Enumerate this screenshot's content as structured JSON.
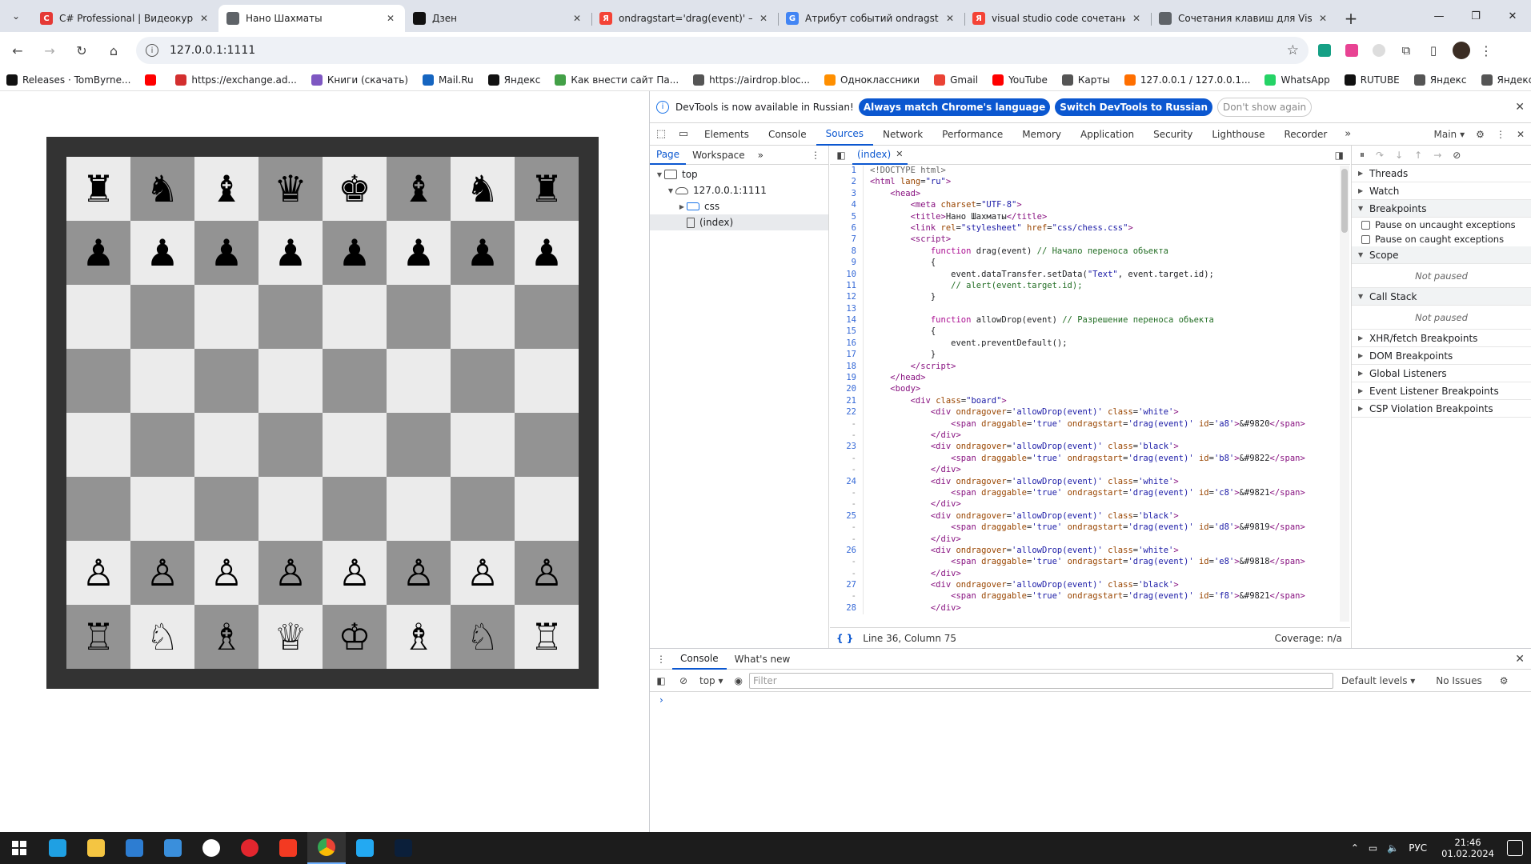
{
  "browser": {
    "tabs": [
      {
        "title": "C# Professional | Видеокурсы |",
        "fav_color": "#e53935",
        "fav_text": "C",
        "active": false
      },
      {
        "title": "Нано Шахматы",
        "fav_color": "#5f6368",
        "fav_text": "",
        "active": true
      },
      {
        "title": "Дзен",
        "fav_color": "#111111",
        "fav_text": "",
        "active": false
      },
      {
        "title": "ondragstart='drag(event)' — Ян",
        "fav_color": "#f44336",
        "fav_text": "Я",
        "active": false
      },
      {
        "title": "Атрибут событий ondragstart",
        "fav_color": "#4285f4",
        "fav_text": "G",
        "active": false
      },
      {
        "title": "visual studio code сочетания к",
        "fav_color": "#f44336",
        "fav_text": "Я",
        "active": false
      },
      {
        "title": "Сочетания клавиш для Visual",
        "fav_color": "#5f6368",
        "fav_text": "",
        "active": false
      }
    ],
    "url": "127.0.0.1:1111",
    "bookmarks": [
      {
        "label": "Releases · TomByrne...",
        "color": "#111111"
      },
      {
        "label": "",
        "color": "#ff0000"
      },
      {
        "label": "https://exchange.ad...",
        "color": "#d32f2f"
      },
      {
        "label": "Книги (скачать)",
        "color": "#7e57c2"
      },
      {
        "label": "Mail.Ru",
        "color": "#1565c0"
      },
      {
        "label": "Яндекс",
        "color": "#111111"
      },
      {
        "label": "Как внести сайт Па...",
        "color": "#43a047"
      },
      {
        "label": "https://airdrop.bloc...",
        "color": "#555555"
      },
      {
        "label": "Одноклассники",
        "color": "#ff8f00"
      },
      {
        "label": "Gmail",
        "color": "#ea4335"
      },
      {
        "label": "YouTube",
        "color": "#ff0000"
      },
      {
        "label": "Карты",
        "color": "#555555"
      },
      {
        "label": "127.0.0.1 / 127.0.0.1...",
        "color": "#ff6f00"
      },
      {
        "label": "WhatsApp",
        "color": "#25d366"
      },
      {
        "label": "RUTUBE",
        "color": "#111111"
      },
      {
        "label": "Яндекс",
        "color": "#555555"
      },
      {
        "label": "Яндекс Маркет",
        "color": "#555555"
      }
    ]
  },
  "board": {
    "rows": [
      [
        "♜",
        "♞",
        "♝",
        "♛",
        "♚",
        "♝",
        "♞",
        "♜"
      ],
      [
        "♟",
        "♟",
        "♟",
        "♟",
        "♟",
        "♟",
        "♟",
        "♟"
      ],
      [
        "",
        "",
        "",
        "",
        "",
        "",
        "",
        ""
      ],
      [
        "",
        "",
        "",
        "",
        "",
        "",
        "",
        ""
      ],
      [
        "",
        "",
        "",
        "",
        "",
        "",
        "",
        ""
      ],
      [
        "",
        "",
        "",
        "",
        "",
        "",
        "",
        ""
      ],
      [
        "♙",
        "♙",
        "♙",
        "♙",
        "♙",
        "♙",
        "♙",
        "♙"
      ],
      [
        "♖",
        "♘",
        "♗",
        "♕",
        "♔",
        "♗",
        "♘",
        "♖"
      ]
    ]
  },
  "devtools": {
    "infobar": {
      "message": "DevTools is now available in Russian!",
      "btn_match": "Always match Chrome's language",
      "btn_switch": "Switch DevTools to Russian",
      "btn_dismiss": "Don't show again"
    },
    "main_tabs": [
      "Elements",
      "Console",
      "Sources",
      "Network",
      "Performance",
      "Memory",
      "Application",
      "Security",
      "Lighthouse",
      "Recorder"
    ],
    "active_tab": "Sources",
    "target": "Main",
    "nav_tabs": [
      "Page",
      "Workspace"
    ],
    "tree": [
      {
        "label": "top",
        "depth": 0,
        "icon": "frame",
        "arrow": "▼"
      },
      {
        "label": "127.0.0.1:1111",
        "depth": 1,
        "icon": "cloud",
        "arrow": "▼"
      },
      {
        "label": "css",
        "depth": 2,
        "icon": "folder",
        "arrow": "▶"
      },
      {
        "label": "(index)",
        "depth": 2,
        "icon": "file",
        "arrow": ""
      }
    ],
    "open_file": "(index)",
    "code": [
      {
        "n": "1",
        "html": "<span class=\"c-doc\">&lt;!DOCTYPE html&gt;</span>"
      },
      {
        "n": "2",
        "html": "<span class=\"c-tag\">&lt;html</span> <span class=\"c-attr\">lang</span>=<span class=\"c-val\">\"ru\"</span><span class=\"c-tag\">&gt;</span>"
      },
      {
        "n": "3",
        "html": "    <span class=\"c-tag\">&lt;head&gt;</span>"
      },
      {
        "n": "4",
        "html": "        <span class=\"c-tag\">&lt;meta</span> <span class=\"c-attr\">charset</span>=<span class=\"c-val\">\"UTF-8\"</span><span class=\"c-tag\">&gt;</span>"
      },
      {
        "n": "5",
        "html": "        <span class=\"c-tag\">&lt;title&gt;</span>Нано Шахматы<span class=\"c-tag\">&lt;/title&gt;</span>"
      },
      {
        "n": "6",
        "html": "        <span class=\"c-tag\">&lt;link</span> <span class=\"c-attr\">rel</span>=<span class=\"c-val\">\"stylesheet\"</span> <span class=\"c-attr\">href</span>=<span class=\"c-val\">\"css/chess.css\"</span><span class=\"c-tag\">&gt;</span>"
      },
      {
        "n": "7",
        "html": "        <span class=\"c-tag\">&lt;script&gt;</span>"
      },
      {
        "n": "8",
        "html": "            <span class=\"c-kw\">function</span> drag(event) <span class=\"c-cm\">// Начало переноса объекта</span>"
      },
      {
        "n": "9",
        "html": "            {"
      },
      {
        "n": "10",
        "html": "                event.dataTransfer.setData(<span class=\"c-val\">\"Text\"</span>, event.target.id);"
      },
      {
        "n": "11",
        "html": "                <span class=\"c-cm\">// alert(event.target.id);</span>"
      },
      {
        "n": "12",
        "html": "            }"
      },
      {
        "n": "13",
        "html": ""
      },
      {
        "n": "14",
        "html": "            <span class=\"c-kw\">function</span> allowDrop(event) <span class=\"c-cm\">// Разрешение переноса объекта</span>"
      },
      {
        "n": "15",
        "html": "            {"
      },
      {
        "n": "16",
        "html": "                event.preventDefault();"
      },
      {
        "n": "17",
        "html": "            }"
      },
      {
        "n": "18",
        "html": "        <span class=\"c-tag\">&lt;/script&gt;</span>"
      },
      {
        "n": "19",
        "html": "    <span class=\"c-tag\">&lt;/head&gt;</span>"
      },
      {
        "n": "20",
        "html": "    <span class=\"c-tag\">&lt;body&gt;</span>"
      },
      {
        "n": "21",
        "html": "        <span class=\"c-tag\">&lt;div</span> <span class=\"c-attr\">class</span>=<span class=\"c-val\">\"board\"</span><span class=\"c-tag\">&gt;</span>"
      },
      {
        "n": "22",
        "html": "            <span class=\"c-tag\">&lt;div</span> <span class=\"c-attr\">ondragover</span>=<span class=\"c-val\">'allowDrop(event)'</span> <span class=\"c-attr\">class</span>=<span class=\"c-val\">'white'</span><span class=\"c-tag\">&gt;</span>"
      },
      {
        "n": "-",
        "html": "                <span class=\"c-tag\">&lt;span</span> <span class=\"c-attr\">draggable</span>=<span class=\"c-val\">'true'</span> <span class=\"c-attr\">ondragstart</span>=<span class=\"c-val\">'drag(event)'</span> <span class=\"c-attr\">id</span>=<span class=\"c-val\">'a8'</span><span class=\"c-tag\">&gt;</span>&amp;#9820<span class=\"c-tag\">&lt;/span&gt;</span>"
      },
      {
        "n": "-",
        "html": "            <span class=\"c-tag\">&lt;/div&gt;</span>"
      },
      {
        "n": "23",
        "html": "            <span class=\"c-tag\">&lt;div</span> <span class=\"c-attr\">ondragover</span>=<span class=\"c-val\">'allowDrop(event)'</span> <span class=\"c-attr\">class</span>=<span class=\"c-val\">'black'</span><span class=\"c-tag\">&gt;</span>"
      },
      {
        "n": "-",
        "html": "                <span class=\"c-tag\">&lt;span</span> <span class=\"c-attr\">draggable</span>=<span class=\"c-val\">'true'</span> <span class=\"c-attr\">ondragstart</span>=<span class=\"c-val\">'drag(event)'</span> <span class=\"c-attr\">id</span>=<span class=\"c-val\">'b8'</span><span class=\"c-tag\">&gt;</span>&amp;#9822<span class=\"c-tag\">&lt;/span&gt;</span>"
      },
      {
        "n": "-",
        "html": "            <span class=\"c-tag\">&lt;/div&gt;</span>"
      },
      {
        "n": "24",
        "html": "            <span class=\"c-tag\">&lt;div</span> <span class=\"c-attr\">ondragover</span>=<span class=\"c-val\">'allowDrop(event)'</span> <span class=\"c-attr\">class</span>=<span class=\"c-val\">'white'</span><span class=\"c-tag\">&gt;</span>"
      },
      {
        "n": "-",
        "html": "                <span class=\"c-tag\">&lt;span</span> <span class=\"c-attr\">draggable</span>=<span class=\"c-val\">'true'</span> <span class=\"c-attr\">ondragstart</span>=<span class=\"c-val\">'drag(event)'</span> <span class=\"c-attr\">id</span>=<span class=\"c-val\">'c8'</span><span class=\"c-tag\">&gt;</span>&amp;#9821<span class=\"c-tag\">&lt;/span&gt;</span>"
      },
      {
        "n": "-",
        "html": "            <span class=\"c-tag\">&lt;/div&gt;</span>"
      },
      {
        "n": "25",
        "html": "            <span class=\"c-tag\">&lt;div</span> <span class=\"c-attr\">ondragover</span>=<span class=\"c-val\">'allowDrop(event)'</span> <span class=\"c-attr\">class</span>=<span class=\"c-val\">'black'</span><span class=\"c-tag\">&gt;</span>"
      },
      {
        "n": "-",
        "html": "                <span class=\"c-tag\">&lt;span</span> <span class=\"c-attr\">draggable</span>=<span class=\"c-val\">'true'</span> <span class=\"c-attr\">ondragstart</span>=<span class=\"c-val\">'drag(event)'</span> <span class=\"c-attr\">id</span>=<span class=\"c-val\">'d8'</span><span class=\"c-tag\">&gt;</span>&amp;#9819<span class=\"c-tag\">&lt;/span&gt;</span>"
      },
      {
        "n": "-",
        "html": "            <span class=\"c-tag\">&lt;/div&gt;</span>"
      },
      {
        "n": "26",
        "html": "            <span class=\"c-tag\">&lt;div</span> <span class=\"c-attr\">ondragover</span>=<span class=\"c-val\">'allowDrop(event)'</span> <span class=\"c-attr\">class</span>=<span class=\"c-val\">'white'</span><span class=\"c-tag\">&gt;</span>"
      },
      {
        "n": "-",
        "html": "                <span class=\"c-tag\">&lt;span</span> <span class=\"c-attr\">draggable</span>=<span class=\"c-val\">'true'</span> <span class=\"c-attr\">ondragstart</span>=<span class=\"c-val\">'drag(event)'</span> <span class=\"c-attr\">id</span>=<span class=\"c-val\">'e8'</span><span class=\"c-tag\">&gt;</span>&amp;#9818<span class=\"c-tag\">&lt;/span&gt;</span>"
      },
      {
        "n": "-",
        "html": "            <span class=\"c-tag\">&lt;/div&gt;</span>"
      },
      {
        "n": "27",
        "html": "            <span class=\"c-tag\">&lt;div</span> <span class=\"c-attr\">ondragover</span>=<span class=\"c-val\">'allowDrop(event)'</span> <span class=\"c-attr\">class</span>=<span class=\"c-val\">'black'</span><span class=\"c-tag\">&gt;</span>"
      },
      {
        "n": "-",
        "html": "                <span class=\"c-tag\">&lt;span</span> <span class=\"c-attr\">draggable</span>=<span class=\"c-val\">'true'</span> <span class=\"c-attr\">ondragstart</span>=<span class=\"c-val\">'drag(event)'</span> <span class=\"c-attr\">id</span>=<span class=\"c-val\">'f8'</span><span class=\"c-tag\">&gt;</span>&amp;#9821<span class=\"c-tag\">&lt;/span&gt;</span>"
      },
      {
        "n": "28",
        "html": "            <span class=\"c-tag\">&lt;/div&gt;</span>"
      }
    ],
    "status": {
      "position": "Line 36, Column 75",
      "coverage": "Coverage: n/a"
    },
    "debugger": {
      "sections": [
        {
          "label": "Threads",
          "open": false
        },
        {
          "label": "Watch",
          "open": false
        },
        {
          "label": "Breakpoints",
          "open": true
        }
      ],
      "checkboxes": [
        "Pause on uncaught exceptions",
        "Pause on caught exceptions"
      ],
      "scope_label": "Scope",
      "not_paused": "Not paused",
      "callstack_label": "Call Stack",
      "more_sections": [
        "XHR/fetch Breakpoints",
        "DOM Breakpoints",
        "Global Listeners",
        "Event Listener Breakpoints",
        "CSP Violation Breakpoints"
      ]
    },
    "drawer": {
      "tabs": [
        "Console",
        "What's new"
      ],
      "context": "top",
      "filter_placeholder": "Filter",
      "levels": "Default levels",
      "issues": "No Issues"
    }
  },
  "taskbar": {
    "apps": [
      {
        "name": "edge",
        "color": "#1fa0e3"
      },
      {
        "name": "explorer",
        "color": "#f4c542"
      },
      {
        "name": "store",
        "color": "#2d7dd2"
      },
      {
        "name": "mail",
        "color": "#3a8fdc"
      },
      {
        "name": "yandex-browser",
        "color": "#ffffff"
      },
      {
        "name": "opera",
        "color": "#e3262e"
      },
      {
        "name": "yandex",
        "color": "#f33a22"
      },
      {
        "name": "chrome",
        "color": "#34a853",
        "active": true
      },
      {
        "name": "vscode",
        "color": "#23a9f2"
      },
      {
        "name": "photoshop",
        "color": "#0b1f3a"
      }
    ],
    "lang": "РУС",
    "time": "21:46",
    "date": "01.02.2024"
  }
}
